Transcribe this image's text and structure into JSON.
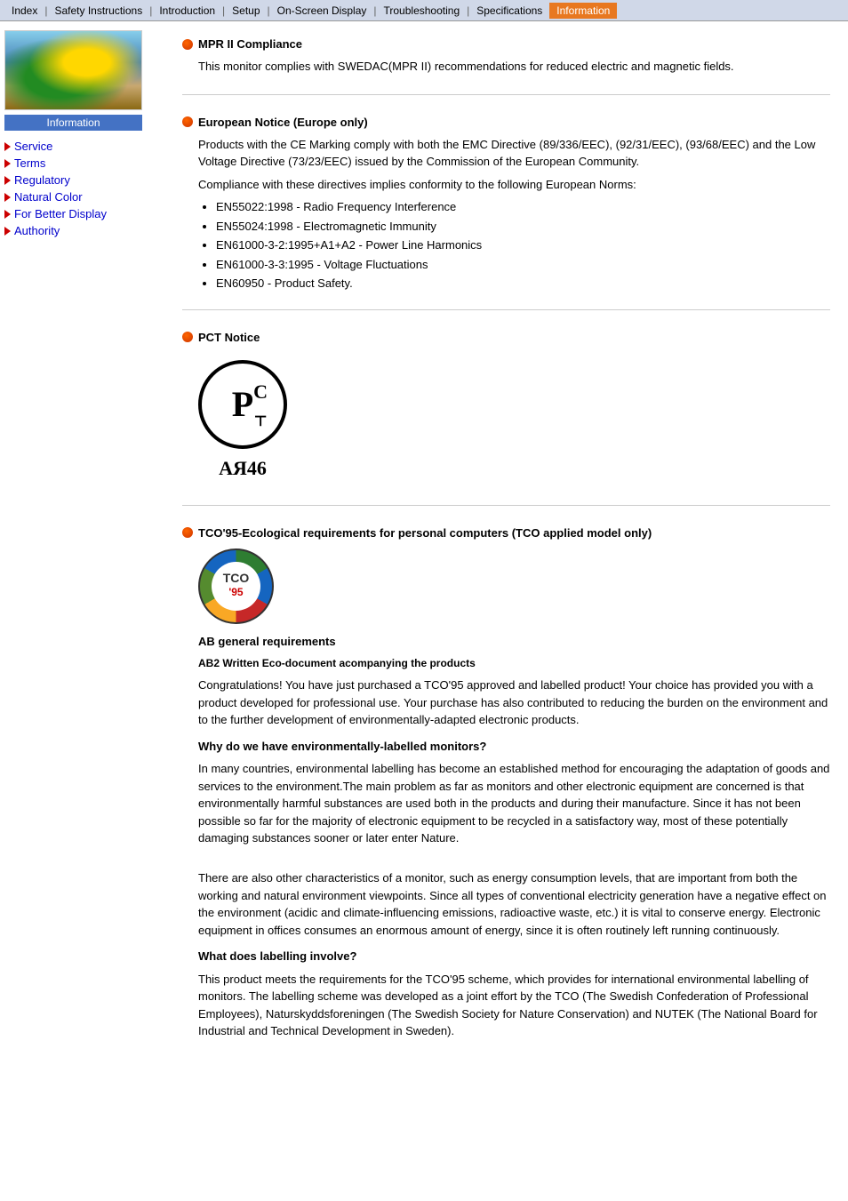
{
  "nav": {
    "items": [
      {
        "label": "Index",
        "active": false
      },
      {
        "label": "Safety Instructions",
        "active": false
      },
      {
        "label": "Introduction",
        "active": false
      },
      {
        "label": "Setup",
        "active": false
      },
      {
        "label": "On-Screen Display",
        "active": false
      },
      {
        "label": "Troubleshooting",
        "active": false
      },
      {
        "label": "Specifications",
        "active": false
      },
      {
        "label": "Information",
        "active": true
      }
    ]
  },
  "sidebar": {
    "label": "Information",
    "links": [
      {
        "text": "Service"
      },
      {
        "text": "Terms"
      },
      {
        "text": "Regulatory"
      },
      {
        "text": "Natural Color"
      },
      {
        "text": "For Better Display"
      },
      {
        "text": "Authority"
      }
    ]
  },
  "sections": [
    {
      "id": "mpr",
      "title": "MPR II Compliance",
      "body": "This monitor complies with SWEDAC(MPR II) recommendations for reduced electric and magnetic fields."
    },
    {
      "id": "european",
      "title": "European Notice (Europe only)",
      "intro": "Products with the CE Marking comply with both the EMC Directive (89/336/EEC), (92/31/EEC), (93/68/EEC) and the Low Voltage Directive (73/23/EEC) issued by the Commission of the European Community.",
      "compliance": "Compliance with these directives implies conformity to the following European Norms:",
      "items": [
        "EN55022:1998 - Radio Frequency Interference",
        "EN55024:1998 - Electromagnetic Immunity",
        "EN61000-3-2:1995+A1+A2 - Power Line Harmonics",
        "EN61000-3-3:1995 - Voltage Fluctuations",
        "EN60950 - Product Safety."
      ]
    },
    {
      "id": "pct",
      "title": "PCT Notice",
      "pct_text": "АЯ46"
    },
    {
      "id": "tco",
      "title": "TCO'95-Ecological requirements for personal computers (TCO applied model only)",
      "ab_general": "AB general requirements",
      "ab2_title": "AB2 Written Eco-document acompanying the products",
      "ab2_body": "Congratulations! You have just purchased a TCO'95 approved and labelled product! Your choice has provided you with a product developed for professional use. Your purchase has also contributed to reducing the burden on the environment and to the further development of environmentally-adapted electronic products.",
      "why_title": "Why do we have environmentally-labelled monitors?",
      "why_body": "In many countries, environmental labelling has become an established method for encouraging the adaptation of goods and services to the environment.The main problem as far as monitors and other electronic equipment are concerned is that environmentally harmful substances are used both in the products and during their manufacture. Since it has not been possible so far for the majority of electronic equipment to be recycled in a satisfactory way, most of these potentially damaging substances sooner or later enter Nature.",
      "why_body2": "There are also other characteristics of a monitor, such as energy consumption levels, that are important from both the working and natural environment viewpoints. Since all types of conventional electricity generation have a negative effect on the environment (acidic and climate-influencing emissions, radioactive waste, etc.) it is vital to conserve energy. Electronic equipment in offices consumes an enormous amount of energy, since it is often routinely left running continuously.",
      "what_title": "What does labelling involve?",
      "what_body": "This product meets the requirements for the TCO'95 scheme, which provides for international environmental labelling of monitors. The labelling scheme was developed as a joint effort by the TCO (The Swedish Confederation of Professional Employees), Naturskyddsforeningen (The Swedish Society for Nature Conservation) and NUTEK (The National Board for Industrial and Technical Development in Sweden)."
    }
  ]
}
